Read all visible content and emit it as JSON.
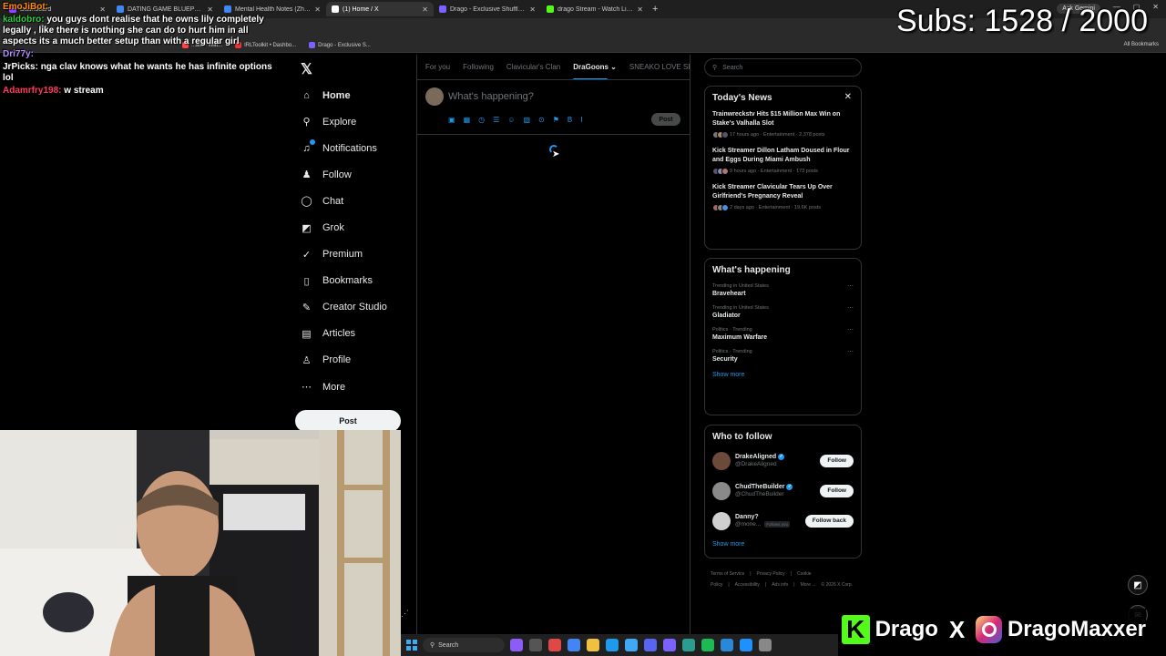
{
  "browser": {
    "tabs": [
      {
        "label": "Dashboard",
        "color": "#9146ff",
        "active": false
      },
      {
        "label": "DATING GAME BLUEPRINT (Be...",
        "color": "#4285f4",
        "active": false
      },
      {
        "label": "Mental Health Notes (Zherka ...",
        "color": "#4285f4",
        "active": false
      },
      {
        "label": "(1) Home / X",
        "color": "#ffffff",
        "active": true
      },
      {
        "label": "Drago - Exclusive Shuffle Rewa...",
        "color": "#7b61ff",
        "active": false
      },
      {
        "label": "drago Stream - Watch Live on K...",
        "color": "#53fc18",
        "active": false
      }
    ],
    "new_tab": "+",
    "gemini": "Ask Gemini",
    "bookmarks": [
      {
        "label": "...am - Wat...",
        "color": "#ff4444"
      },
      {
        "label": "IRLToolkit • Dashbo...",
        "color": "#e33"
      },
      {
        "label": "Drago - Exclusive S...",
        "color": "#7b61ff"
      }
    ],
    "all_bookmarks": "All Bookmarks"
  },
  "x": {
    "nav": [
      {
        "label": "Home",
        "icon": "home-icon",
        "glyph": "⌂",
        "active": true
      },
      {
        "label": "Explore",
        "icon": "search-icon",
        "glyph": "⚲",
        "active": false
      },
      {
        "label": "Notifications",
        "icon": "bell-icon",
        "glyph": "♫",
        "active": false,
        "dot": true
      },
      {
        "label": "Follow",
        "icon": "person-add-icon",
        "glyph": "♟",
        "active": false
      },
      {
        "label": "Chat",
        "icon": "chat-icon",
        "glyph": "◯",
        "active": false
      },
      {
        "label": "Grok",
        "icon": "grok-icon",
        "glyph": "◩",
        "active": false
      },
      {
        "label": "Premium",
        "icon": "premium-icon",
        "glyph": "✓",
        "active": false
      },
      {
        "label": "Bookmarks",
        "icon": "bookmark-icon",
        "glyph": "▯",
        "active": false
      },
      {
        "label": "Creator Studio",
        "icon": "creator-studio-icon",
        "glyph": "✎",
        "active": false
      },
      {
        "label": "Articles",
        "icon": "articles-icon",
        "glyph": "▤",
        "active": false
      },
      {
        "label": "Profile",
        "icon": "profile-icon",
        "glyph": "♙",
        "active": false
      },
      {
        "label": "More",
        "icon": "more-icon",
        "glyph": "⋯",
        "active": false
      }
    ],
    "post_button": "Post",
    "feed_tabs": [
      {
        "label": "For you",
        "active": false
      },
      {
        "label": "Following",
        "active": false
      },
      {
        "label": "Clavicular's Clan",
        "active": false
      },
      {
        "label": "DraGoons ⌄",
        "active": true
      },
      {
        "label": "SNEAKO LOVE SP",
        "active": false
      }
    ],
    "composer": {
      "placeholder": "What's happening?",
      "post_label": "Post",
      "tools": [
        "▣",
        "▦",
        "◷",
        "☰",
        "☺",
        "▧",
        "⊙",
        "⚑",
        "B",
        "I"
      ]
    },
    "search_placeholder": "Search",
    "todays_news": {
      "title": "Today's News",
      "items": [
        {
          "headline": "Trainwreckstv Hits $15 Million Max Win on Stake's Valhalla Slot",
          "meta": "17 hours ago · Entertainment · 2,378 posts"
        },
        {
          "headline": "Kick Streamer Dillon Latham Doused in Flour and Eggs During Miami Ambush",
          "meta": "9 hours ago · Entertainment · 173 posts"
        },
        {
          "headline": "Kick Streamer Clavicular Tears Up Over Girlfriend's Pregnancy Reveal",
          "meta": "2 days ago · Entertainment · 19.6K posts"
        }
      ]
    },
    "whats_happening": {
      "title": "What's happening",
      "items": [
        {
          "context": "Trending in United States",
          "topic": "Braveheart"
        },
        {
          "context": "Trending in United States",
          "topic": "Gladiator"
        },
        {
          "context": "Politics · Trending",
          "topic": "Maximum Warfare"
        },
        {
          "context": "Politics · Trending",
          "topic": "Security"
        }
      ],
      "show_more": "Show more"
    },
    "who_to_follow": {
      "title": "Who to follow",
      "items": [
        {
          "name": "DrakeAligned",
          "handle": "@DrakeAligned",
          "verified": true,
          "button": "Follow",
          "color": "#6b4a3a"
        },
        {
          "name": "ChudTheBuilder",
          "handle": "@ChudTheBuilder",
          "verified": true,
          "button": "Follow",
          "color": "#8a8a8a"
        },
        {
          "name": "Danny?",
          "handle": "@mone...",
          "verified": false,
          "follows_you": "Follows you",
          "button": "Follow back",
          "color": "#d0d0d0"
        }
      ],
      "show_more": "Show more"
    },
    "footer": [
      "Terms of Service",
      "|",
      "Privacy Policy",
      "|",
      "Cookie Policy",
      "|",
      "Accessibility",
      "|",
      "Ads info",
      "|",
      "More ...",
      "© 2026 X Corp."
    ]
  },
  "stream": {
    "chat": [
      {
        "user": "EmoJiBot:",
        "user_color": "#ff8c00",
        "text": ""
      },
      {
        "user": "kaldobro:",
        "user_color": "#2ecc40",
        "text": "you guys dont realise that he owns lily completely legally , like there is nothing she can do to hurt him in all aspects its a much better setup than with a regular girl"
      },
      {
        "user": "Dri77y:",
        "user_color": "#b48cff",
        "text": ""
      },
      {
        "user": "JrPicks:",
        "user_color": "#ffffff",
        "text": "nga clav knows what he wants he has infinite options lol"
      },
      {
        "user": "Adamrfry198:",
        "user_color": "#ff3b5c",
        "text": "w stream"
      }
    ],
    "subs_goal": "Subs: 1528 / 2000",
    "brand_kick": "K",
    "brand_name_1": "Drago",
    "brand_x": "X",
    "brand_name_2": "DragoMaxxer"
  },
  "taskbar": {
    "search": "Search",
    "icons": [
      "#8b5cf6",
      "#555",
      "#e04848",
      "#4285f4",
      "#f0c040",
      "#1b9aee",
      "#3fa9f5",
      "#5865f2",
      "#7b61ff",
      "#2a9d8f",
      "#1db954",
      "#2b88d8",
      "#1e90ff",
      "#888"
    ]
  },
  "colors": {
    "accent": "#1d9bf0",
    "kick": "#53fc18"
  }
}
